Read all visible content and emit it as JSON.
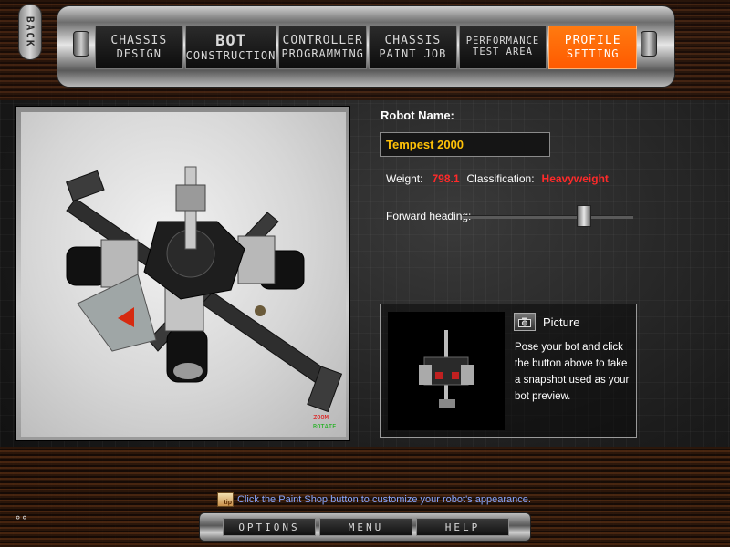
{
  "back_label": "BACK",
  "nav_tabs": [
    {
      "line1": "CHASSIS",
      "line2": "DESIGN"
    },
    {
      "line1": "BOT",
      "line2": "CONSTRUCTION"
    },
    {
      "line1": "CONTROLLER",
      "line2": "PROGRAMMING"
    },
    {
      "line1": "CHASSIS",
      "line2": "PAINT JOB"
    },
    {
      "line1": "PERFORMANCE",
      "line2": "TEST AREA"
    },
    {
      "line1": "PROFILE",
      "line2": "SETTING"
    }
  ],
  "active_tab": "PROFILE SETTING",
  "viewport": {
    "zoom_hint": "ZOOM",
    "rotate_hint": "ROTATE"
  },
  "form": {
    "name_label": "Robot Name:",
    "name_value": "Tempest 2000",
    "weight_label": "Weight:",
    "weight_value": "798.1",
    "class_label": "Classification:",
    "class_value": "Heavyweight",
    "heading_label": "Forward heading:",
    "heading_level": 0.73
  },
  "picture": {
    "title": "Picture",
    "description": "Pose your bot and click the button above to take a snapshot used as your bot preview."
  },
  "tip": {
    "icon_text": "tip",
    "text": "Click the Paint Shop button to customize your robot's appearance."
  },
  "bottom_menu": [
    "OPTIONS",
    "MENU",
    "HELP"
  ],
  "sys_icon": "°°",
  "colors": {
    "accent": "#ff6600",
    "value_red": "#ff2a2a",
    "name_yellow": "#ffc107",
    "tip_blue": "#8aa8ff"
  }
}
